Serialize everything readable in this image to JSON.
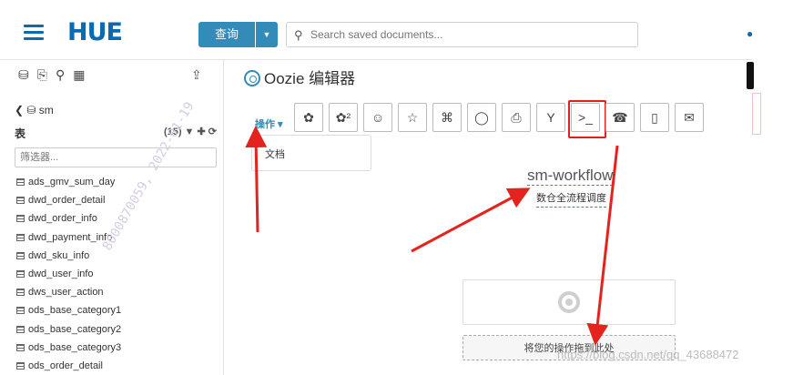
{
  "header": {
    "logo_text": "HUE",
    "query_label": "查询",
    "search_placeholder": "Search saved documents..."
  },
  "sidebar": {
    "database": "sm",
    "tables_label": "表",
    "table_count": "(15)",
    "filter_placeholder": "筛选器...",
    "tables": [
      "ads_gmv_sum_day",
      "dwd_order_detail",
      "dwd_order_info",
      "dwd_payment_info",
      "dwd_sku_info",
      "dwd_user_info",
      "dws_user_action",
      "ods_base_category1",
      "ods_base_category2",
      "ods_base_category3",
      "ods_order_detail"
    ]
  },
  "editor": {
    "title": "Oozie 编辑器",
    "actions_label": "操作",
    "popup_item": "文档",
    "workflow_name": "sm-workflow",
    "workflow_desc": "数仓全流程调度",
    "drop_label": "将您的操作拖到此处",
    "toolbar": [
      {
        "icon": "hive-icon",
        "glyph": "✿"
      },
      {
        "icon": "hive2-icon",
        "glyph": "✿²"
      },
      {
        "icon": "pig-icon",
        "glyph": "☺"
      },
      {
        "icon": "spark-icon",
        "glyph": "☆"
      },
      {
        "icon": "java-icon",
        "glyph": "⌘"
      },
      {
        "icon": "sqoop-icon",
        "glyph": "◯"
      },
      {
        "icon": "mapreduce-icon",
        "glyph": "⎙"
      },
      {
        "icon": "subworkflow-icon",
        "glyph": "Y"
      },
      {
        "icon": "shell-icon",
        "glyph": ">_"
      },
      {
        "icon": "ssh-icon",
        "glyph": "☎"
      },
      {
        "icon": "file-icon",
        "glyph": "▯"
      },
      {
        "icon": "email-icon",
        "glyph": "✉"
      }
    ]
  },
  "overlays": {
    "diag_watermark": "8000870059, 2022-01-19",
    "blog_watermark": "https://blog.csdn.net/qq_43688472"
  }
}
